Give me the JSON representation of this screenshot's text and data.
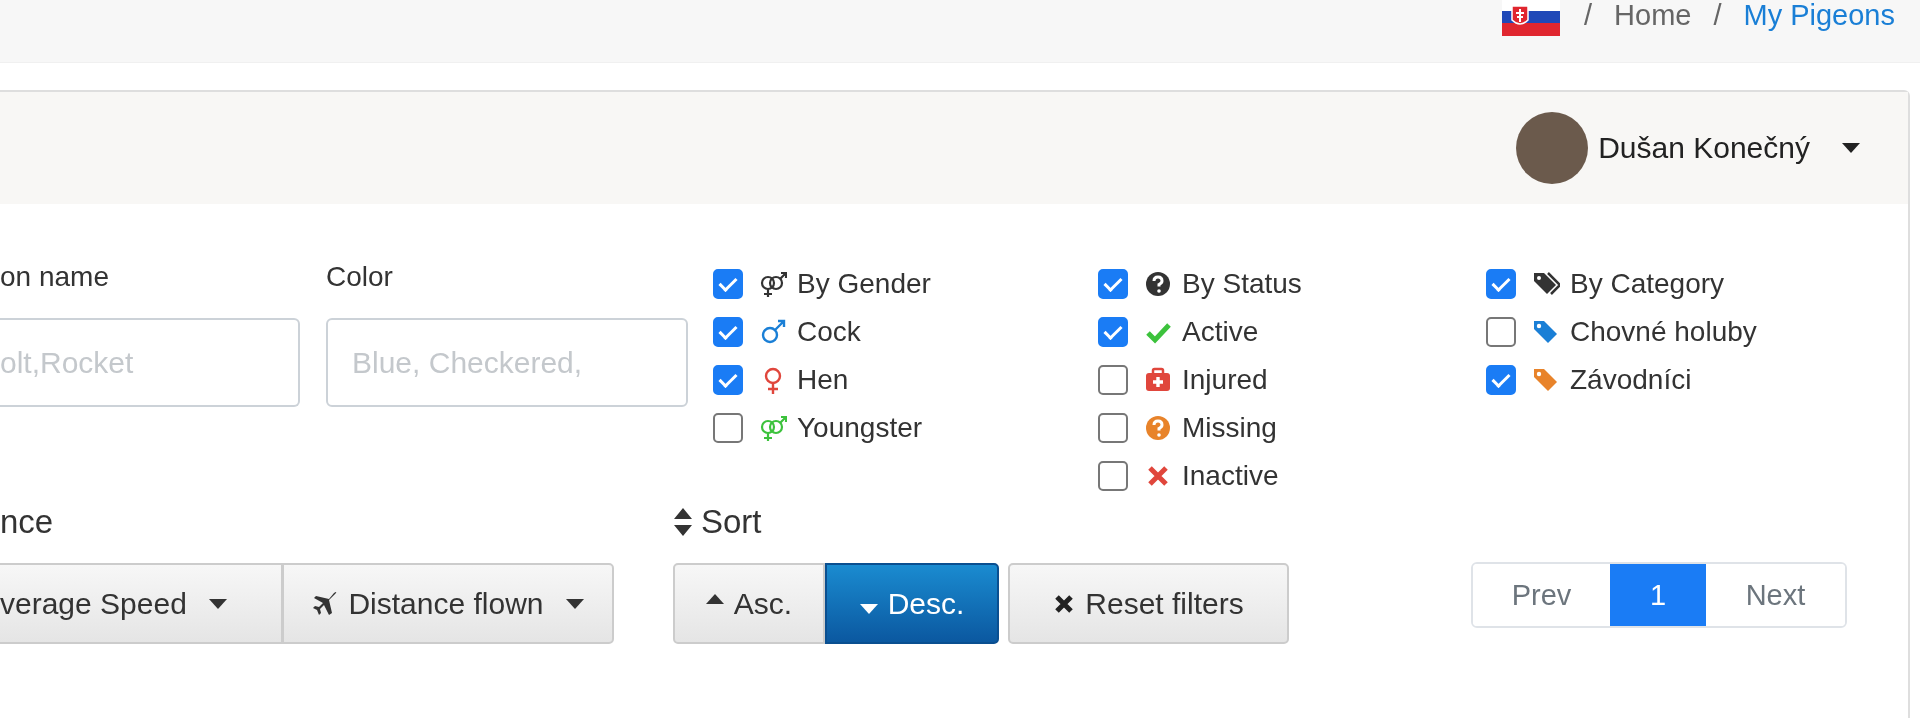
{
  "breadcrumb": [
    {
      "separator": "/",
      "label": "Home",
      "current": false
    },
    {
      "separator": "/",
      "label": "My Pigeons",
      "current": true
    }
  ],
  "user": {
    "name": "Dušan Konečný"
  },
  "fields": [
    {
      "label": "on name",
      "placeholder": "olt,Rocket",
      "clipped": true
    },
    {
      "label": "Color",
      "placeholder": "Blue, Checkered,",
      "clipped": false
    }
  ],
  "checkbox_groups": [
    [
      {
        "label": "By Gender",
        "checked": true,
        "kind": "gender-pair",
        "color": "#333333"
      },
      {
        "label": "Cock",
        "checked": true,
        "kind": "male",
        "color": "#1a7fd6"
      },
      {
        "label": "Hen",
        "checked": true,
        "kind": "female",
        "color": "#e0463c"
      },
      {
        "label": "Youngster",
        "checked": false,
        "kind": "gender-pair",
        "color": "#3cc23c"
      }
    ],
    [
      {
        "label": "By Status",
        "checked": true,
        "kind": "question",
        "color": "#333333"
      },
      {
        "label": "Active",
        "checked": true,
        "kind": "check",
        "color": "#3cc23c"
      },
      {
        "label": "Injured",
        "checked": false,
        "kind": "medkit",
        "color": "#e0463c"
      },
      {
        "label": "Missing",
        "checked": false,
        "kind": "question",
        "color": "#e8832a"
      },
      {
        "label": "Inactive",
        "checked": false,
        "kind": "cross",
        "color": "#e0463c"
      }
    ],
    [
      {
        "label": "By Category",
        "checked": true,
        "kind": "tags",
        "color": "#333333"
      },
      {
        "label": "Chovné holuby",
        "checked": false,
        "kind": "tag",
        "color": "#1a7fd6"
      },
      {
        "label": "Závodníci",
        "checked": true,
        "kind": "tag",
        "color": "#e8832a"
      }
    ]
  ],
  "distance": {
    "heading": "nce",
    "dropdowns": [
      {
        "label": "verage Speed",
        "kind": "plain",
        "clipped": true
      },
      {
        "label": "Distance flown",
        "kind": "plane",
        "clipped": false
      }
    ]
  },
  "sort": {
    "heading": "Sort",
    "buttons": [
      {
        "label": "Asc.",
        "kind": "up",
        "selected": false
      },
      {
        "label": "Desc.",
        "kind": "down",
        "selected": true
      }
    ],
    "reset": "Reset filters"
  },
  "pagination": {
    "prev": "Prev",
    "pages": [
      {
        "label": "1",
        "selected": true
      }
    ],
    "next": "Next"
  }
}
